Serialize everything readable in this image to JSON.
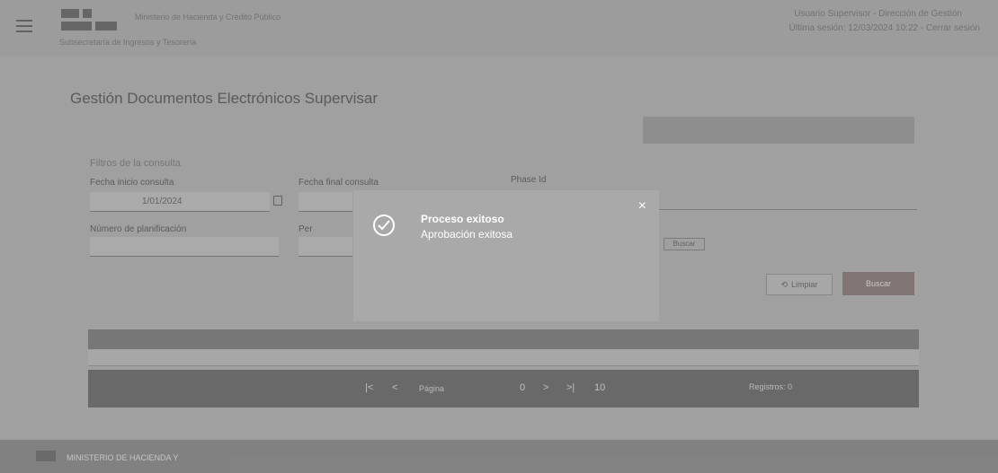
{
  "header": {
    "org_title": "Ministerio de Hacienda y Crédito Público",
    "org_subtitle": "Subsecretaría de Ingresos y Tesorería",
    "user_line1": "Usuario Supervisor - Dirección de Gestión",
    "user_line2": "Última sesión: 12/03/2024 10:22 - Cerrar sesión"
  },
  "page": {
    "title": "Gestión Documentos Electrónicos Supervisar"
  },
  "filters": {
    "section_label": "Filtros de la consulta",
    "start_date_label": "Fecha inicio consulta",
    "start_date_value": "1/01/2024",
    "end_date_label": "Fecha final consulta",
    "phase_label": "Phase Id",
    "planning_label": "Número de planificación",
    "per_label": "Per",
    "clean_button": "Limpiar",
    "search_button": "Buscar",
    "chip_label": "Buscar"
  },
  "pager": {
    "first": "|<",
    "prev": "<",
    "label": "Página",
    "current": "0",
    "next": ">",
    "last": ">|",
    "size": "10",
    "count": "Registros: 0"
  },
  "modal": {
    "close": "×",
    "title": "Proceso exitoso",
    "message": "Aprobación exitosa"
  },
  "footer": {
    "text": "MINISTERIO DE HACIENDA Y"
  },
  "colors": {
    "overlay": "#a9a9a9",
    "search_button": "#7c6e6a"
  }
}
